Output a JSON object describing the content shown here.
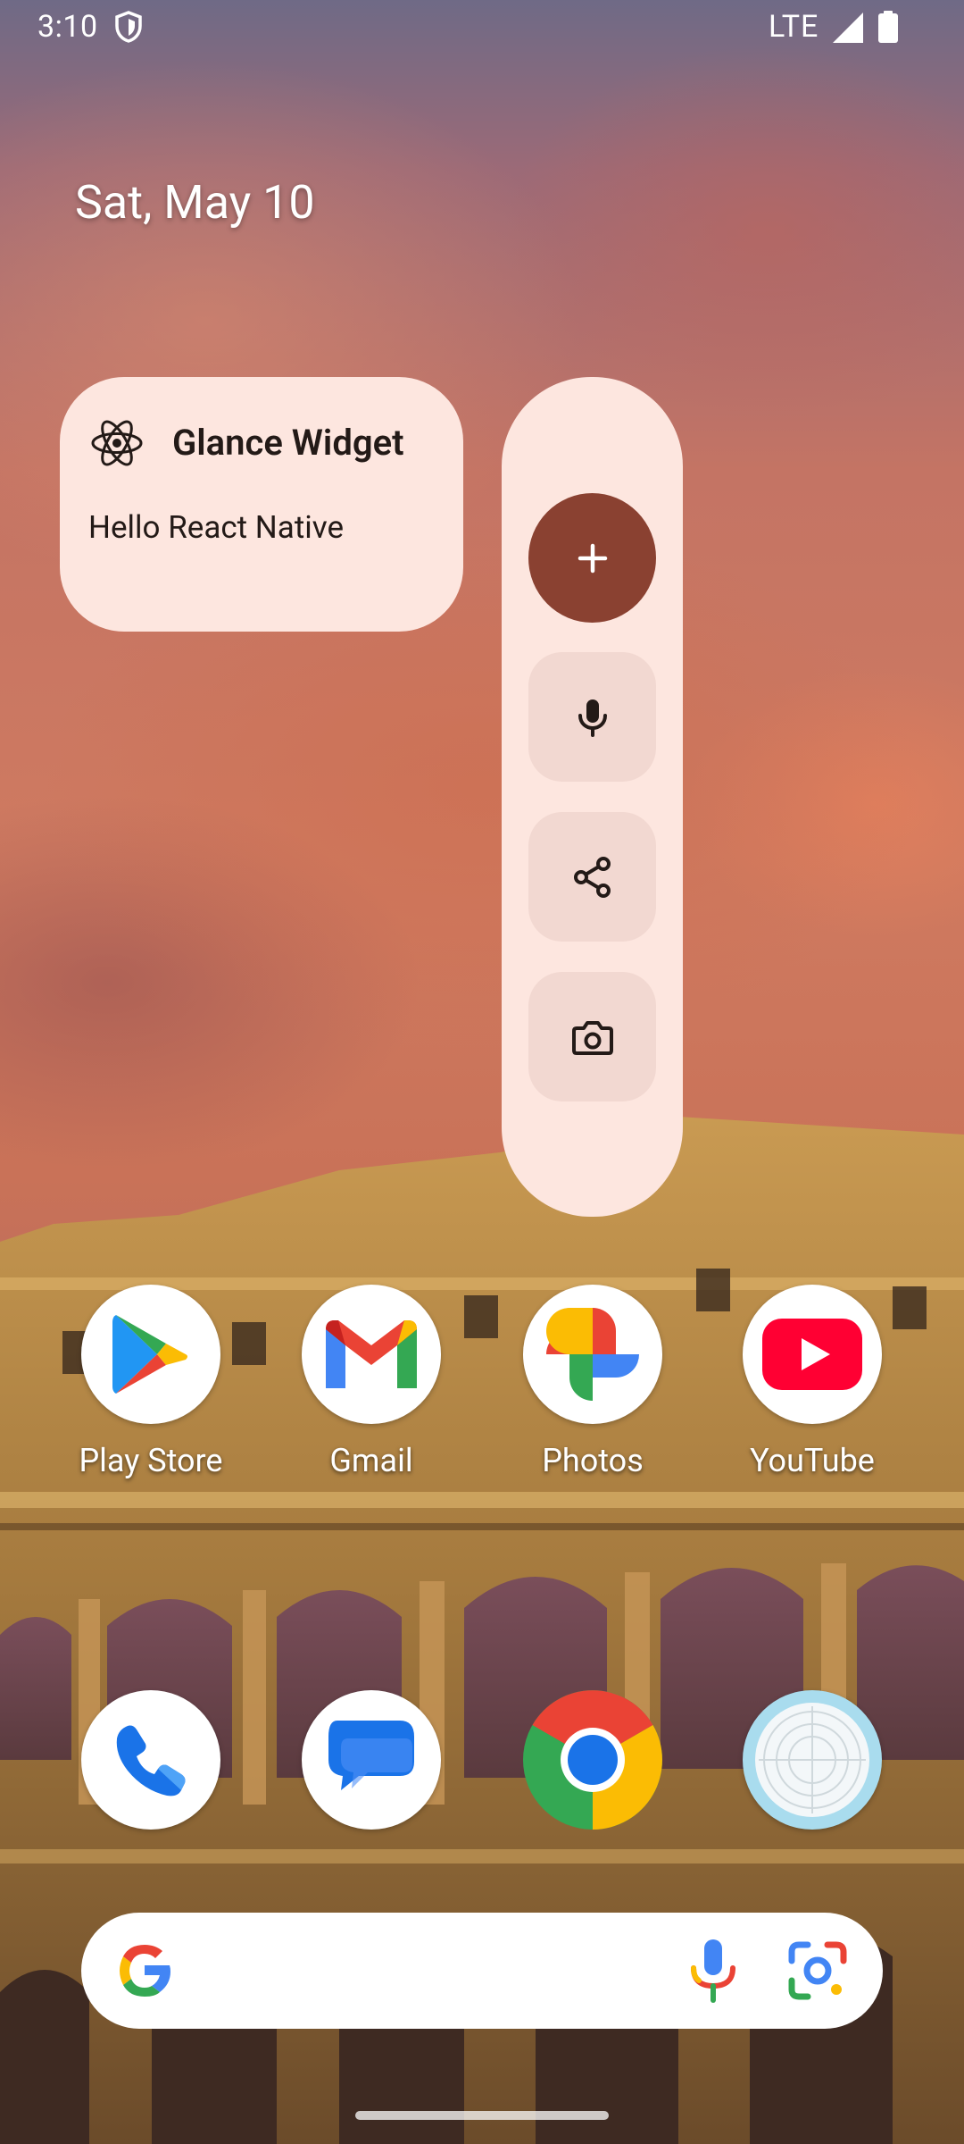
{
  "status_bar": {
    "time": "3:10",
    "network": "LTE",
    "icons": [
      "shield-icon",
      "signal-icon",
      "battery-icon"
    ]
  },
  "home": {
    "date": "Sat, May 10"
  },
  "glance_widget": {
    "icon": "react-icon",
    "title": "Glance Widget",
    "text": "Hello React Native",
    "background": "#fde6df"
  },
  "action_widget": {
    "buttons": [
      {
        "icon": "plus-icon"
      },
      {
        "icon": "mic-icon"
      },
      {
        "icon": "share-icon"
      },
      {
        "icon": "camera-icon"
      }
    ],
    "primary_color": "#8a4131",
    "button_color": "#f2d8d1"
  },
  "apps_row1": [
    {
      "label": "Play Store",
      "icon": "play-store-icon"
    },
    {
      "label": "Gmail",
      "icon": "gmail-icon"
    },
    {
      "label": "Photos",
      "icon": "photos-icon"
    },
    {
      "label": "YouTube",
      "icon": "youtube-icon"
    }
  ],
  "dock": [
    {
      "icon": "phone-icon"
    },
    {
      "icon": "messages-icon"
    },
    {
      "icon": "chrome-icon"
    },
    {
      "icon": "camera-app-icon"
    }
  ],
  "search_bar": {
    "icons": [
      "google-logo-icon",
      "voice-search-icon",
      "lens-icon"
    ]
  }
}
